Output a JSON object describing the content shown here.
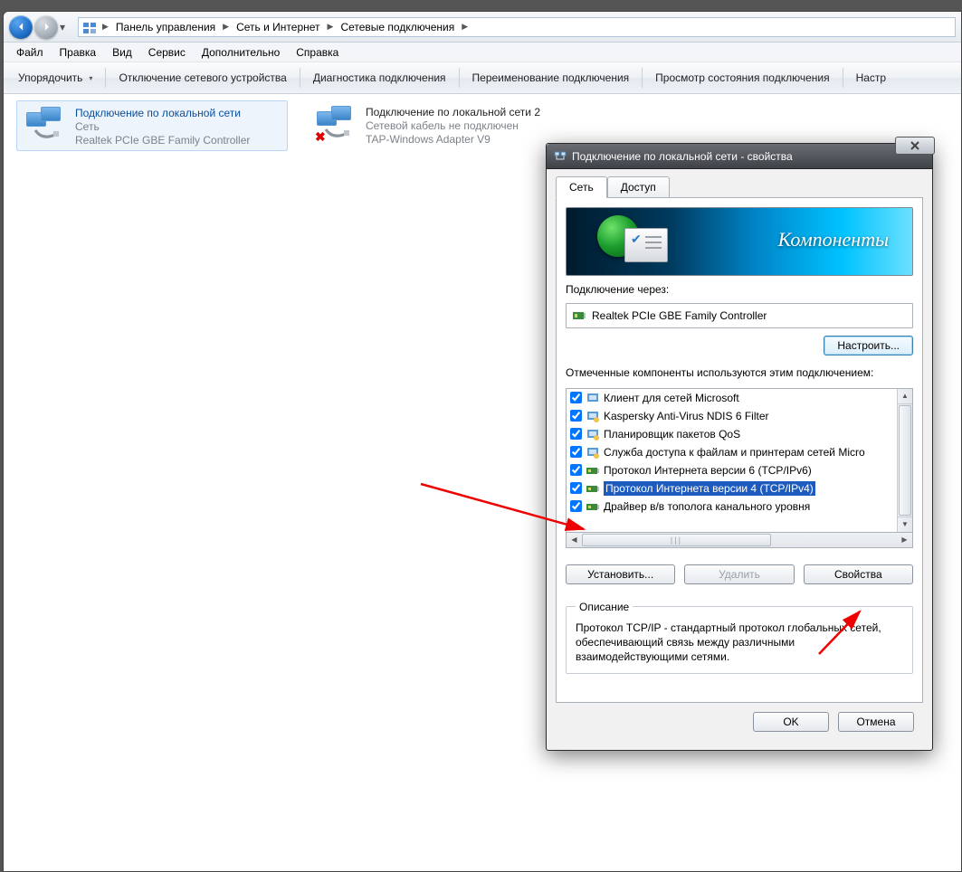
{
  "breadcrumbs": {
    "root": "Панель управления",
    "mid": "Сеть и Интернет",
    "leaf": "Сетевые подключения"
  },
  "menu": {
    "file": "Файл",
    "edit": "Правка",
    "view": "Вид",
    "tools": "Сервис",
    "advanced": "Дополнительно",
    "help": "Справка"
  },
  "toolbar": {
    "organize": "Упорядочить",
    "disable": "Отключение сетевого устройства",
    "diagnose": "Диагностика подключения",
    "rename": "Переименование подключения",
    "status": "Просмотр состояния подключения",
    "settings": "Настр"
  },
  "connections": [
    {
      "title": "Подключение по локальной сети",
      "sub1": "Сеть",
      "sub2": "Realtek PCIe GBE Family Controller",
      "selected": true,
      "broken": false
    },
    {
      "title": "Подключение по локальной сети 2",
      "sub1": "Сетевой кабель не подключен",
      "sub2": "TAP-Windows Adapter V9",
      "selected": false,
      "broken": true
    }
  ],
  "dialog": {
    "title": "Подключение по локальной сети - свойства",
    "tabs": {
      "net": "Сеть",
      "access": "Доступ"
    },
    "banner": "Компоненты",
    "conn_through": "Подключение через:",
    "device": "Realtek PCIe GBE Family Controller",
    "configure": "Настроить...",
    "used_label": "Отмеченные компоненты используются этим подключением:",
    "components": [
      {
        "label": "Клиент для сетей Microsoft",
        "checked": true,
        "kind": "client",
        "selected": false
      },
      {
        "label": "Kaspersky Anti-Virus NDIS 6 Filter",
        "checked": true,
        "kind": "service",
        "selected": false
      },
      {
        "label": "Планировщик пакетов QoS",
        "checked": true,
        "kind": "service",
        "selected": false
      },
      {
        "label": "Служба доступа к файлам и принтерам сетей Micro",
        "checked": true,
        "kind": "service",
        "selected": false
      },
      {
        "label": "Протокол Интернета версии 6 (TCP/IPv6)",
        "checked": true,
        "kind": "protocol",
        "selected": false
      },
      {
        "label": "Протокол Интернета версии 4 (TCP/IPv4)",
        "checked": true,
        "kind": "protocol",
        "selected": true
      },
      {
        "label": "Драйвер в/в тополога канального уровня",
        "checked": true,
        "kind": "protocol",
        "selected": false
      }
    ],
    "install": "Установить...",
    "remove": "Удалить",
    "properties": "Свойства",
    "desc_legend": "Описание",
    "desc_text": "Протокол TCP/IP - стандартный протокол глобальных сетей, обеспечивающий связь между различными взаимодействующими сетями.",
    "ok": "OK",
    "cancel": "Отмена"
  }
}
